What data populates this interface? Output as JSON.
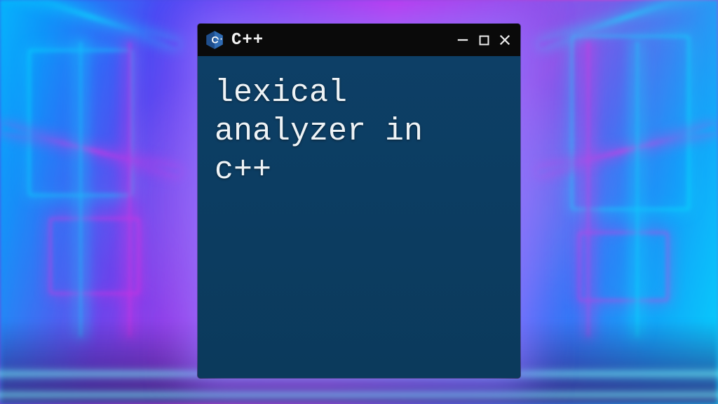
{
  "window": {
    "title": "C++",
    "icon_name": "cpp-hex-icon",
    "controls": {
      "minimize_name": "minimize-icon",
      "maximize_name": "maximize-icon",
      "close_name": "close-icon"
    }
  },
  "content": {
    "text": "lexical\nanalyzer in\nc++"
  },
  "colors": {
    "window_bg": "#0b3a5c",
    "titlebar_bg": "#0a0a0a",
    "text": "#eef3f6",
    "cpp_icon_fill": "#1f4e8c",
    "cpp_icon_accent": "#2f6bb3"
  }
}
